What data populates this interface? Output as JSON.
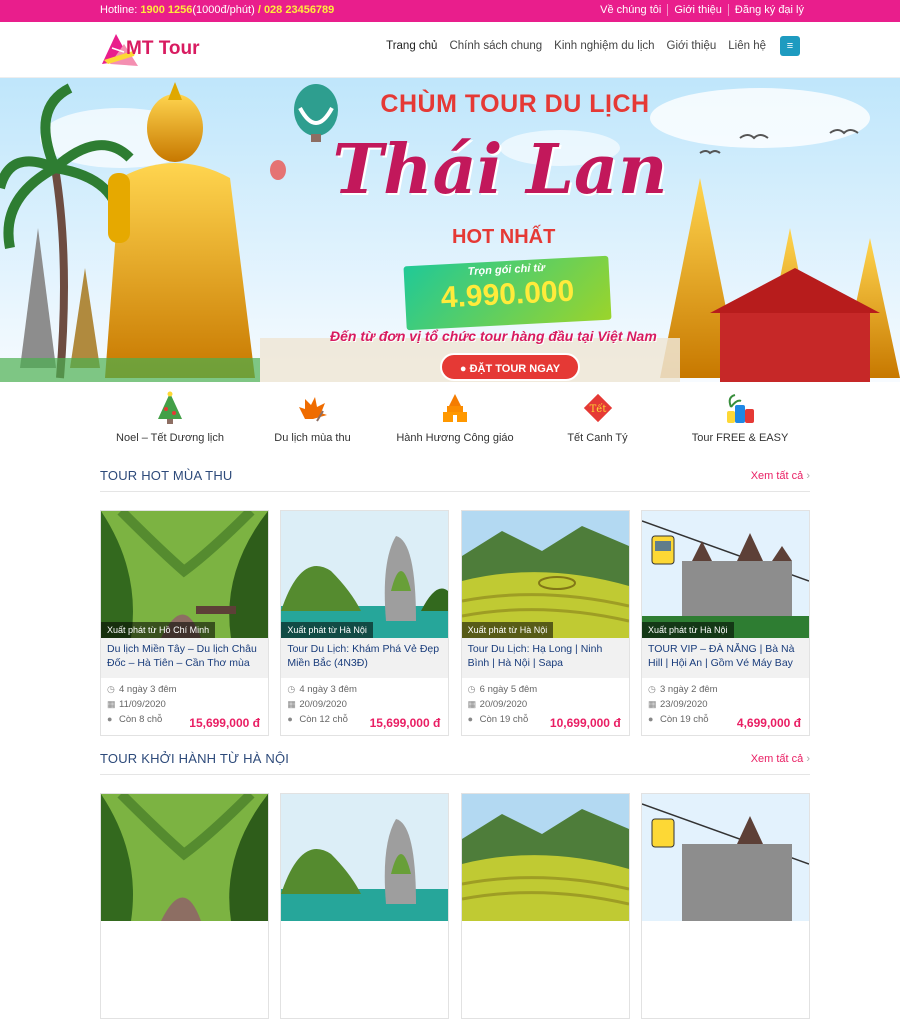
{
  "topbar": {
    "hotline_label": "Hotline:",
    "hotline_number": "1900 1256",
    "hotline_rate": "(1000đ/phút)",
    "hotline_sep": "/",
    "hotline_number2": "028 23456789",
    "links": [
      "Về chúng tôi",
      "Giới thiệu",
      "Đăng ký đại lý"
    ]
  },
  "header": {
    "logo_text": "MT Tour",
    "nav": [
      "Trang chủ",
      "Chính sách chung",
      "Kinh nghiệm du lịch",
      "Giới thiệu",
      "Liên hệ"
    ],
    "menu_icon": "≡"
  },
  "banner": {
    "line1": "CHÙM TOUR DU LỊCH",
    "line2": "Thái Lan",
    "line3": "HOT NHẤT",
    "price_label": "Trọn gói chỉ từ",
    "price": "4.990.000",
    "tagline": "Đến từ đơn vị tổ chức tour hàng đầu tại Việt Nam",
    "cta": "ĐẶT TOUR NGAY"
  },
  "categories": [
    {
      "label": "Noel – Tết Dương lịch",
      "icon": "christmas-tree-icon"
    },
    {
      "label": "Du lịch mùa thu",
      "icon": "autumn-leaves-icon"
    },
    {
      "label": "Hành Hương Công giáo",
      "icon": "temple-icon"
    },
    {
      "label": "Tết Canh Tý",
      "icon": "tet-icon"
    },
    {
      "label": "Tour FREE & EASY",
      "icon": "luggage-icon"
    }
  ],
  "sections": [
    {
      "title": "TOUR HOT MÙA THU",
      "more": "Xem tất cả",
      "cards": [
        {
          "badge": "Xuất phát từ Hồ Chí Minh",
          "title": "Du lịch Miền Tây – Du lịch Châu Đốc – Hà Tiên – Cần Thơ mùa",
          "duration": "4 ngày 3 đêm",
          "date": "11/09/2020",
          "seats": "Còn 8 chỗ",
          "price": "15,699,000 đ"
        },
        {
          "badge": "Xuất phát từ Hà Nội",
          "title": "Tour Du Lịch: Khám Phá Vẻ Đẹp Miền Bắc (4N3Đ)",
          "duration": "4 ngày 3 đêm",
          "date": "20/09/2020",
          "seats": "Còn 12 chỗ",
          "price": "15,699,000 đ"
        },
        {
          "badge": "Xuất phát từ Hà Nội",
          "title": "Tour Du Lịch: Hạ Long | Ninh Bình | Hà Nội | Sapa",
          "duration": "6 ngày 5 đêm",
          "date": "20/09/2020",
          "seats": "Còn 19 chỗ",
          "price": "10,699,000 đ"
        },
        {
          "badge": "Xuất phát từ Hà Nội",
          "title": "TOUR VIP – ĐÀ NẴNG | Bà Nà Hill | Hội An | Gồm Vé Máy Bay",
          "duration": "3 ngày 2 đêm",
          "date": "23/09/2020",
          "seats": "Còn 19 chỗ",
          "price": "4,699,000 đ"
        }
      ]
    },
    {
      "title": "TOUR KHỞI HÀNH TỪ HÀ NỘI",
      "more": "Xem tất cả"
    }
  ]
}
